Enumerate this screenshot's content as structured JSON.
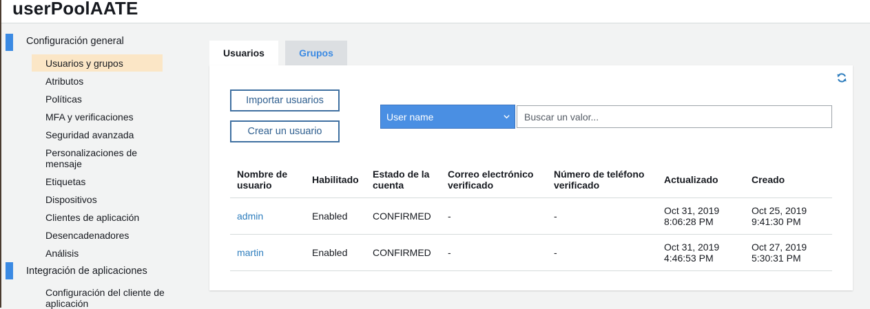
{
  "page": {
    "title": "userPoolAATE"
  },
  "sidebar": {
    "sections": [
      {
        "label": "Configuración general",
        "items": [
          "Usuarios y grupos",
          "Atributos",
          "Políticas",
          "MFA y verificaciones",
          "Seguridad avanzada",
          "Personalizaciones de mensaje",
          "Etiquetas",
          "Dispositivos",
          "Clientes de aplicación",
          "Desencadenadores",
          "Análisis"
        ],
        "active_item": "Usuarios y grupos"
      },
      {
        "label": "Integración de aplicaciones",
        "items": [
          "Configuración del cliente de aplicación"
        ]
      }
    ]
  },
  "tabs": [
    {
      "label": "Usuarios",
      "active": true
    },
    {
      "label": "Grupos",
      "active": false
    }
  ],
  "actions": {
    "import_label": "Importar usuarios",
    "create_label": "Crear un usuario"
  },
  "filter": {
    "attribute_selected": "User name",
    "search_placeholder": "Buscar un valor..."
  },
  "table": {
    "headers": [
      "Nombre de usuario",
      "Habilitado",
      "Estado de la cuenta",
      "Correo electrónico verificado",
      "Número de teléfono verificado",
      "Actualizado",
      "Creado"
    ],
    "rows": [
      [
        "admin",
        "Enabled",
        "CONFIRMED",
        "-",
        "-",
        "Oct 31, 2019 8:06:28 PM",
        "Oct 25, 2019 9:41:30 PM"
      ],
      [
        "martin",
        "Enabled",
        "CONFIRMED",
        "-",
        "-",
        "Oct 31, 2019 4:46:53 PM",
        "Oct 27, 2019 5:30:31 PM"
      ]
    ]
  },
  "colors": {
    "accent": "#3b8ae3",
    "active_nav_bg": "#fbe6c6",
    "link": "#2d7dbd",
    "select_bg": "#4a8fe3"
  },
  "icons": {
    "refresh": "refresh-icon",
    "dropdown": "chevron-down-icon"
  }
}
